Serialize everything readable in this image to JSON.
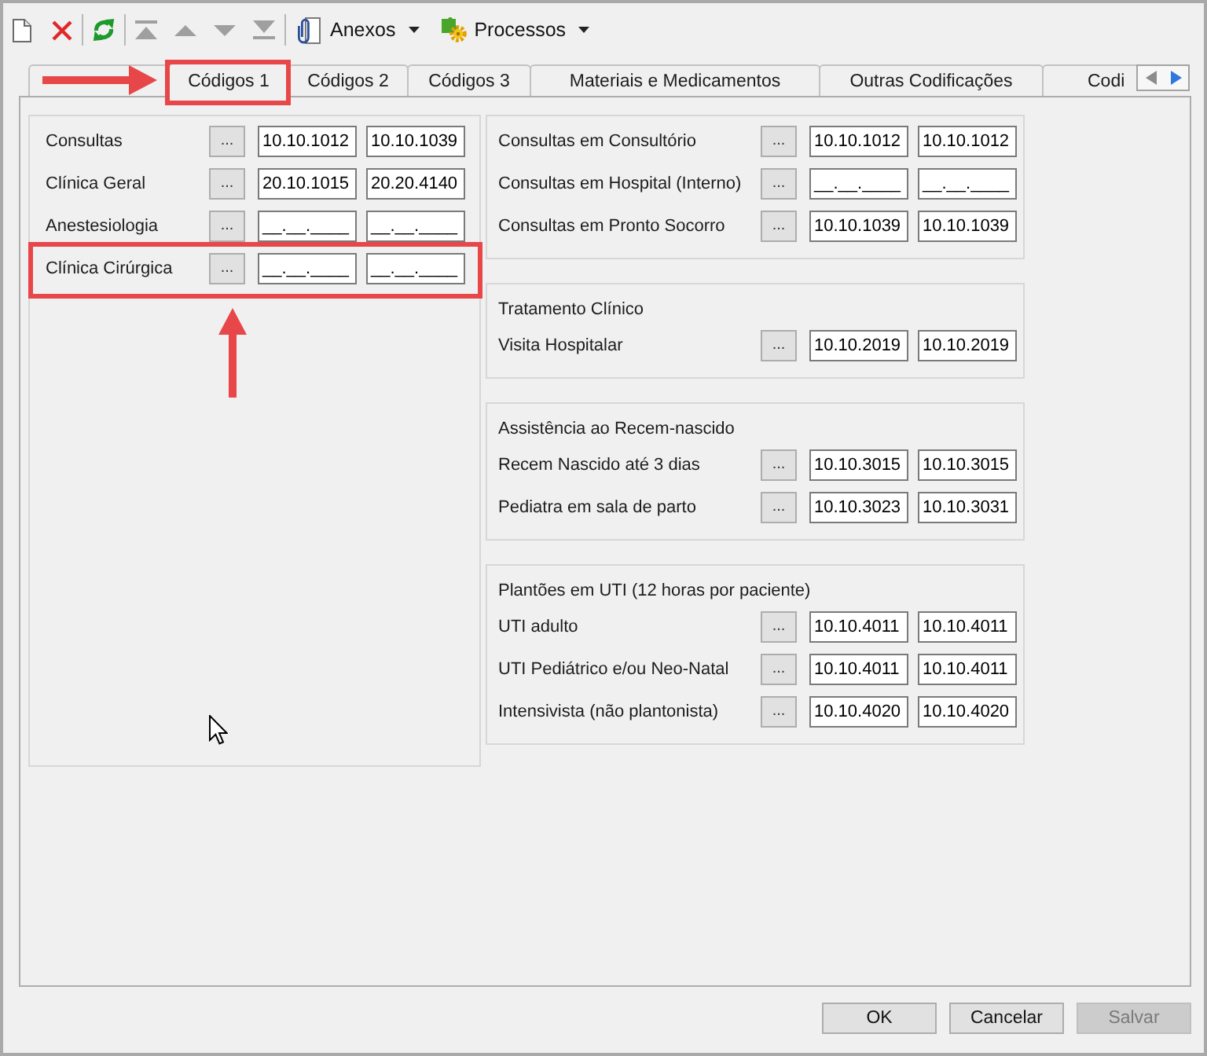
{
  "toolbar": [
    {
      "kind": "icon",
      "disabled": false
    },
    {
      "kind": "icon",
      "disabled": false
    },
    {
      "kind": "separator"
    },
    {
      "kind": "icon",
      "disabled": false
    },
    {
      "kind": "separator"
    },
    {
      "kind": "icon",
      "disabled": true
    },
    {
      "kind": "icon",
      "disabled": true
    },
    {
      "kind": "icon",
      "disabled": true
    },
    {
      "kind": "icon",
      "disabled": true
    },
    {
      "kind": "separator"
    },
    {
      "kind": "menu",
      "label": "Anexos"
    },
    {
      "kind": "menu",
      "label": "Processos"
    }
  ],
  "tabs": [
    {
      "selected": false
    },
    {
      "label": "Códigos 1",
      "selected": true,
      "annotated": true
    },
    {
      "label": "Códigos 2",
      "selected": false
    },
    {
      "label": "Códigos 3",
      "selected": false
    },
    {
      "label": "Materiais e Medicamentos",
      "selected": false
    },
    {
      "label": "Outras Codificações",
      "selected": false
    },
    {
      "label": "Codi",
      "selected": false
    }
  ],
  "tab_scroller": [
    {
      "disabled": true
    },
    {
      "disabled": false
    }
  ],
  "panel": {
    "left_column": [
      {
        "rows": [
          {
            "label": "Consultas",
            "button": "...",
            "codes": [
              "10.10.1012",
              "10.10.1039"
            ]
          },
          {
            "label": "Clínica Geral",
            "button": "...",
            "codes": [
              "20.10.1015",
              "20.20.4140"
            ]
          },
          {
            "label": "Anestesiologia",
            "button": "...",
            "codes": [
              "__.__.____",
              "__.__.____"
            ]
          },
          {
            "label": "Clínica Cirúrgica",
            "button": "...",
            "codes": [
              "__.__.____",
              "__.__.____"
            ],
            "annotated": true
          }
        ]
      }
    ],
    "right_column": [
      {
        "rows": [
          {
            "label": "Consultas em Consultório",
            "button": "...",
            "codes": [
              "10.10.1012",
              "10.10.1012"
            ]
          },
          {
            "label": "Consultas em Hospital (Interno)",
            "button": "...",
            "codes": [
              "__.__.____",
              "__.__.____"
            ]
          },
          {
            "label": "Consultas em Pronto Socorro",
            "button": "...",
            "codes": [
              "10.10.1039",
              "10.10.1039"
            ]
          }
        ]
      },
      {
        "title": "Tratamento Clínico",
        "rows": [
          {
            "label": "Visita Hospitalar",
            "button": "...",
            "codes": [
              "10.10.2019",
              "10.10.2019"
            ]
          }
        ]
      },
      {
        "title": "Assistência ao Recem-nascido",
        "rows": [
          {
            "label": "Recem Nascido até 3 dias",
            "button": "...",
            "codes": [
              "10.10.3015",
              "10.10.3015"
            ]
          },
          {
            "label": "Pediatra em sala de parto",
            "button": "...",
            "codes": [
              "10.10.3023",
              "10.10.3031"
            ]
          }
        ]
      },
      {
        "title": "Plantões em UTI (12 horas por paciente)",
        "rows": [
          {
            "label": "UTI adulto",
            "button": "...",
            "codes": [
              "10.10.4011",
              "10.10.4011"
            ]
          },
          {
            "label": "UTI Pediátrico e/ou Neo-Natal",
            "button": "...",
            "codes": [
              "10.10.4011",
              "10.10.4011"
            ]
          },
          {
            "label": "Intensivista (não plantonista)",
            "button": "...",
            "codes": [
              "10.10.4020",
              "10.10.4020"
            ]
          }
        ]
      }
    ]
  },
  "buttons": [
    {
      "label": "OK",
      "disabled": false
    },
    {
      "label": "Cancelar",
      "disabled": false
    },
    {
      "label": "Salvar",
      "disabled": true
    }
  ]
}
